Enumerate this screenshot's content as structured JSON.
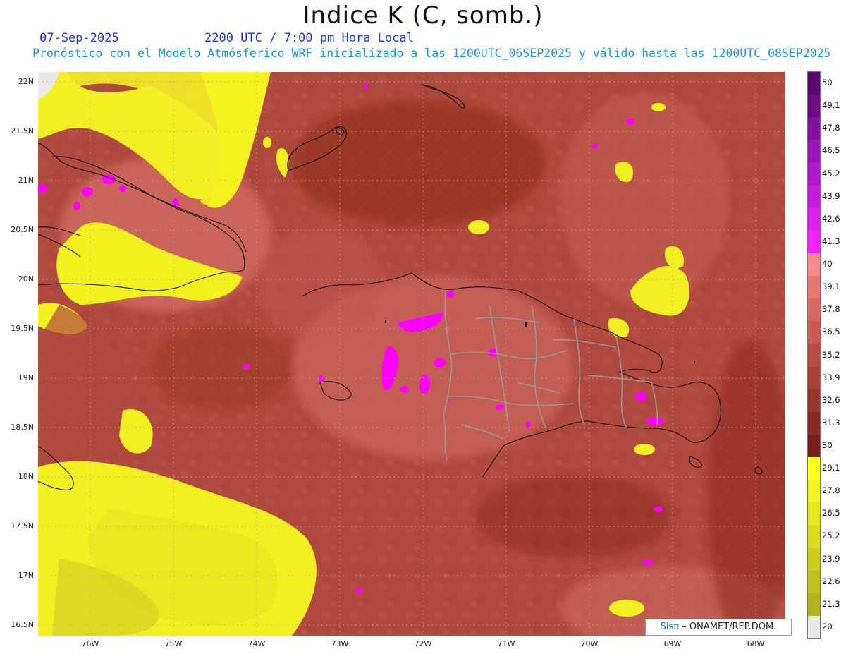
{
  "title": "Indice K (C, somb.)",
  "subtitle": {
    "date": "07-Sep-2025",
    "time": "2200 UTC / 7:00 pm Hora Local",
    "description": "Pronóstico con el Modelo Atmósferico WRF inicializado a las 1200UTC_06SEP2025 y válido hasta las  1200UTC_08SEP2025"
  },
  "axes": {
    "lat_labels": [
      "22N",
      "21.5N",
      "21N",
      "20.5N",
      "20N",
      "19.5N",
      "19N",
      "18.5N",
      "18N",
      "17.5N",
      "17N",
      "16.5N"
    ],
    "lon_labels": [
      "76W",
      "75W",
      "74W",
      "73W",
      "72W",
      "71W",
      "70W",
      "69W",
      "68W"
    ]
  },
  "colorbar": {
    "labels": [
      "50",
      "49.1",
      "47.8",
      "46.5",
      "45.2",
      "43.9",
      "42.6",
      "41.3",
      "40",
      "39.1",
      "37.8",
      "36.5",
      "35.2",
      "33.9",
      "32.6",
      "31.3",
      "30",
      "29.1",
      "27.8",
      "26.5",
      "25.2",
      "23.9",
      "22.6",
      "21.3",
      "20"
    ],
    "colors": [
      "#5a0a6e",
      "#6e0c88",
      "#8410a0",
      "#9a14b8",
      "#b018cc",
      "#c61cde",
      "#dc20ee",
      "#f020ff",
      "#f58a8a",
      "#e87570",
      "#d86860",
      "#c85a50",
      "#b84c42",
      "#a84036",
      "#98352c",
      "#882a22",
      "#7a2018",
      "#ffff20",
      "#f4f420",
      "#e8e820",
      "#dcdc20",
      "#cece20",
      "#c0c020",
      "#b2b220",
      "#e8e8e8"
    ]
  },
  "credit": {
    "sis": "Sisπ",
    "org": "– ONAMET/REP.DOM."
  }
}
